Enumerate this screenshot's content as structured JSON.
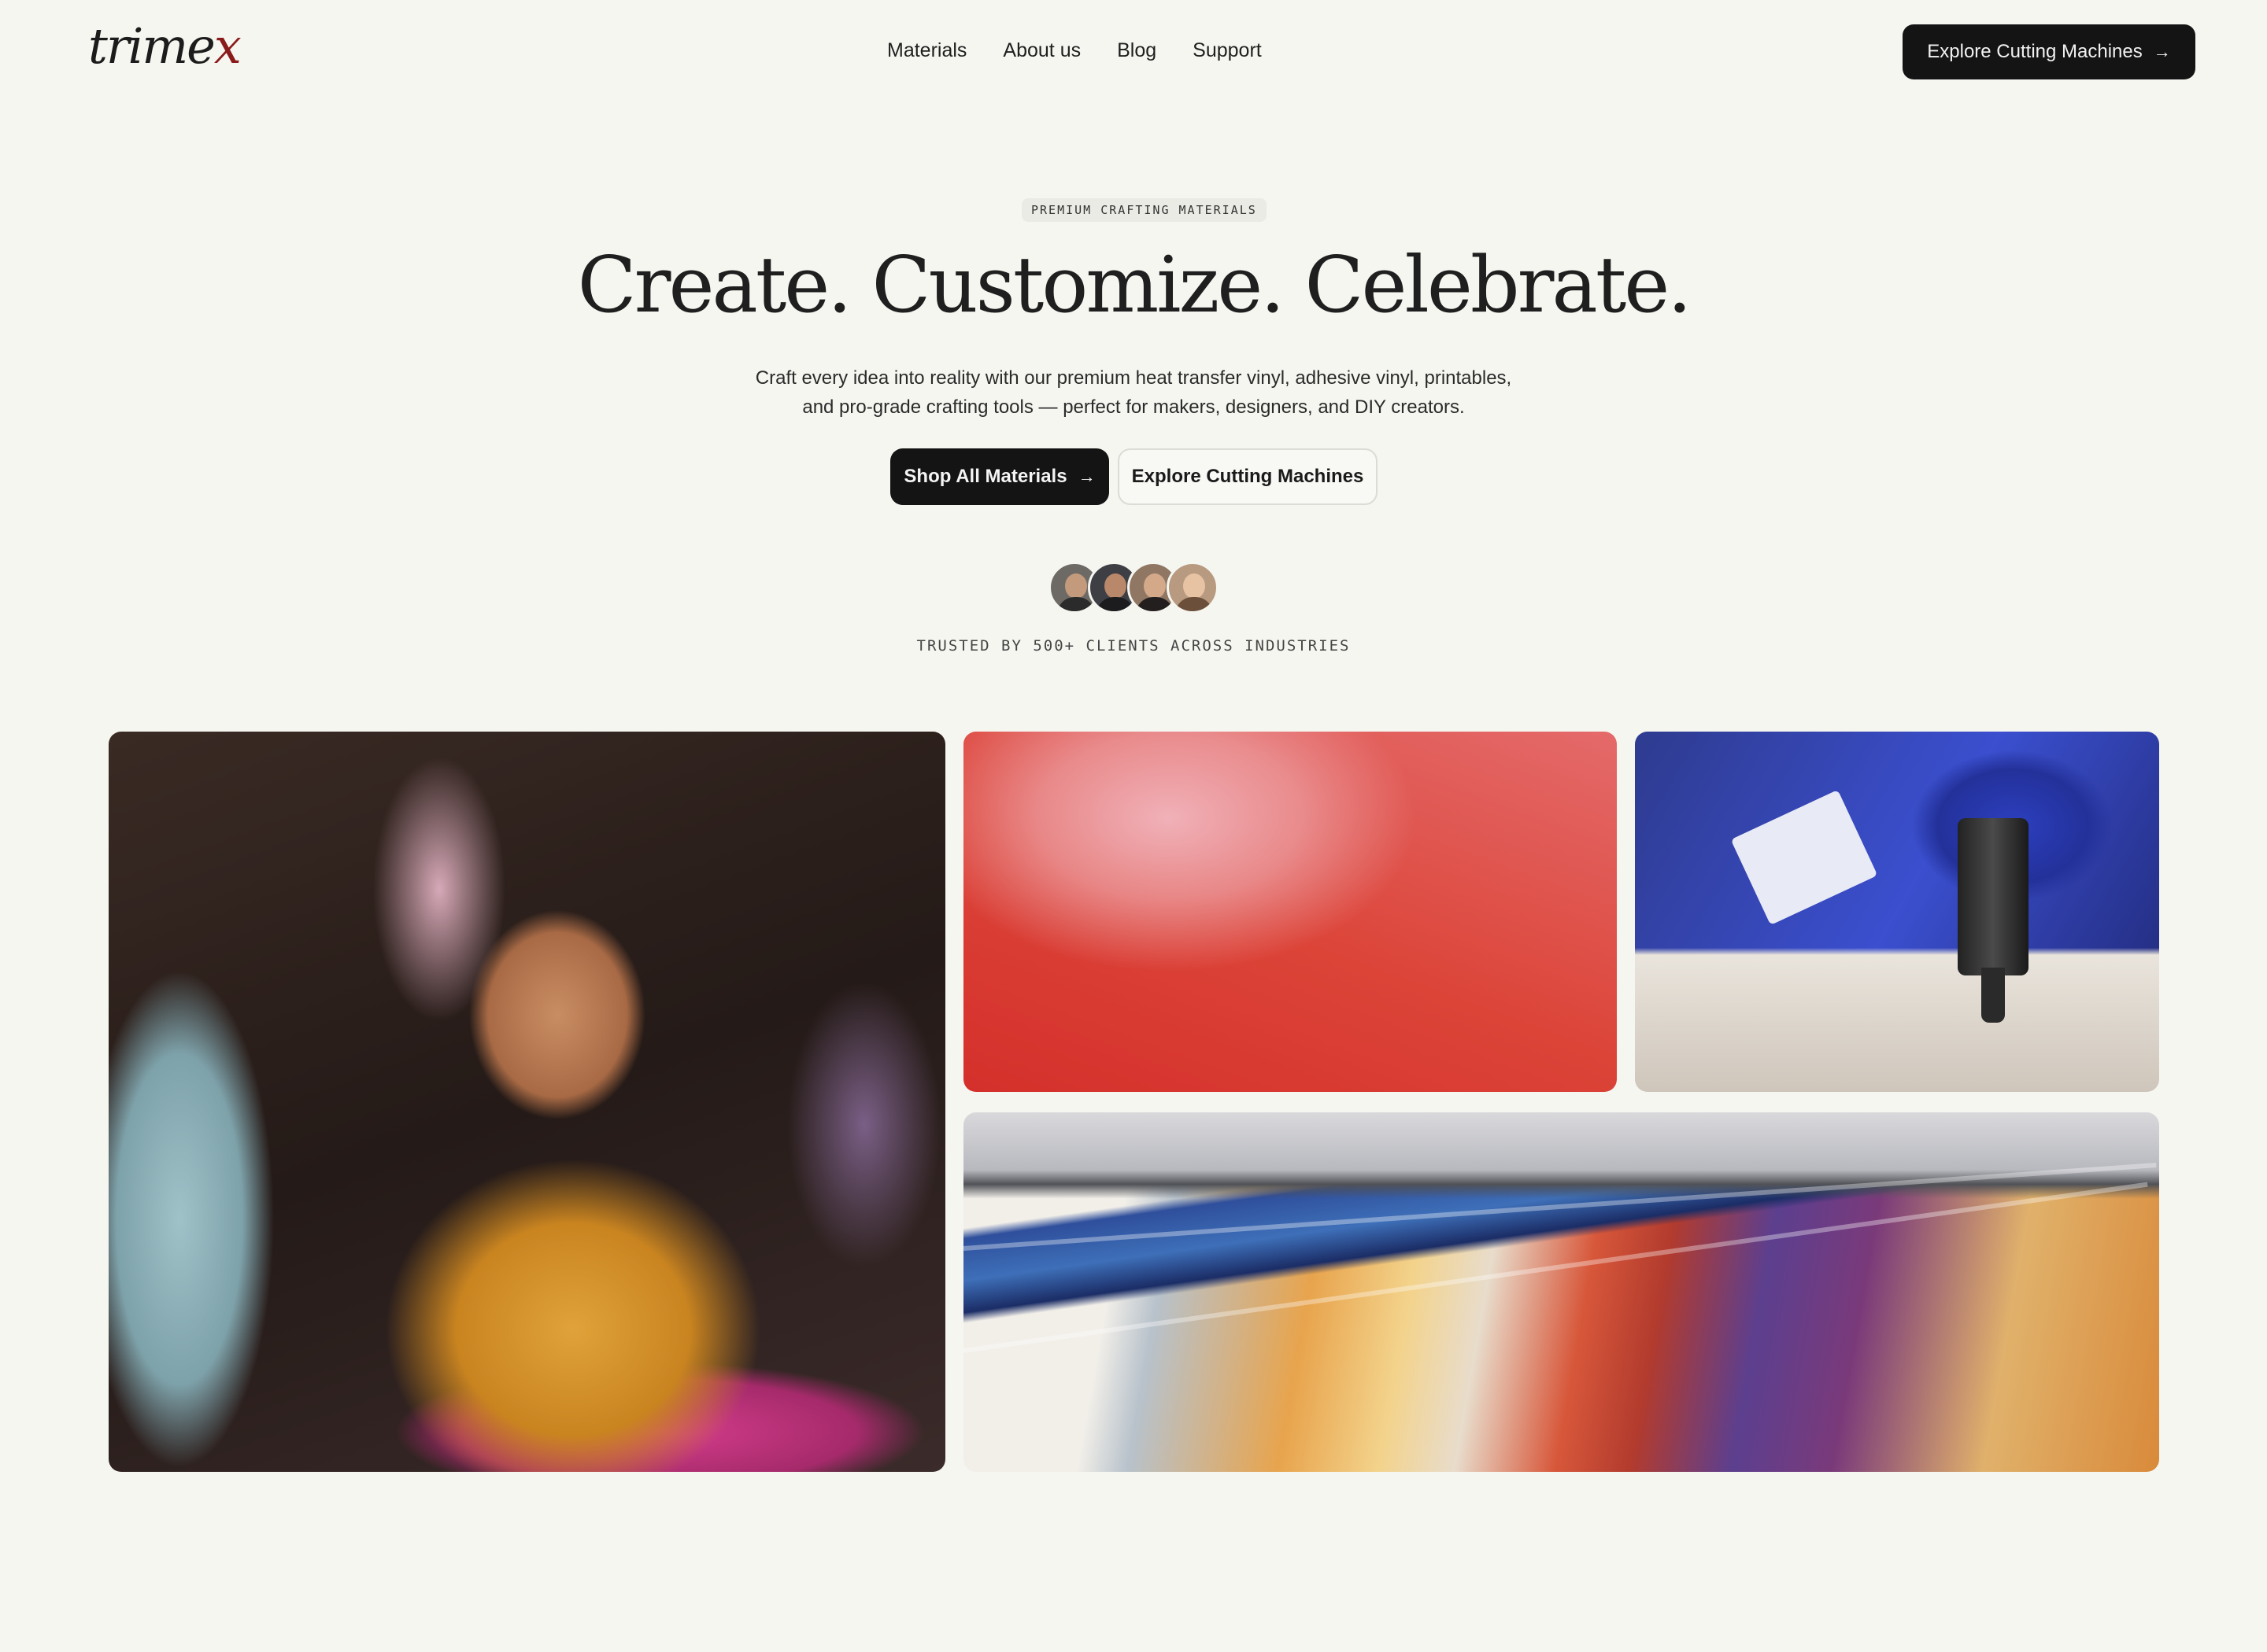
{
  "nav": {
    "logo_text": "trimex",
    "links": [
      "Materials",
      "About us",
      "Blog",
      "Support"
    ],
    "cta_label": "Explore Cutting Machines",
    "cta_icon": "arrow-right-icon"
  },
  "hero": {
    "eyebrow": "PREMIUM CRAFTING MATERIALS",
    "headline": "Create. Customize. Celebrate.",
    "subtext_line1": "Craft every idea into reality with our premium heat transfer vinyl, adhesive vinyl, printables,",
    "subtext_line2": "and pro-grade crafting tools — perfect for makers, designers, and DIY creators.",
    "primary_button": "Shop All Materials",
    "primary_icon": "arrow-right-icon",
    "secondary_button": "Explore Cutting Machines",
    "avatar_count": 4,
    "trusted_text": "TRUSTED BY 500+ CLIENTS ACROSS INDUSTRIES"
  },
  "colors": {
    "background": "#f6f6f1",
    "primary": "#141414",
    "text": "#1f1f1f"
  }
}
